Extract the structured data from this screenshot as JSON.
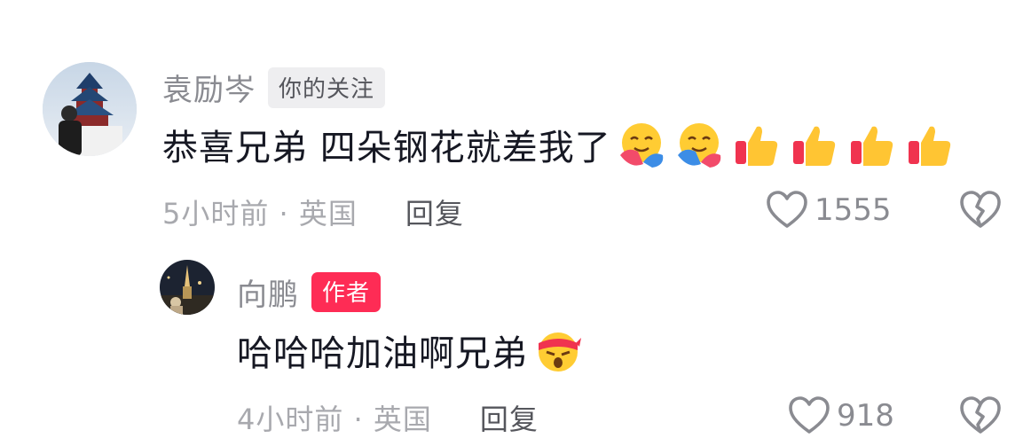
{
  "comments": [
    {
      "username": "袁励岑",
      "badge": "你的关注",
      "text": "恭喜兄弟 四朵钢花就差我了",
      "emojis": [
        "hug-emoji",
        "hug-emoji",
        "thumbs-up-emoji",
        "thumbs-up-emoji",
        "thumbs-up-emoji",
        "thumbs-up-emoji"
      ],
      "time_location": "5小时前 · 英国",
      "reply_label": "回复",
      "like_count": "1555"
    },
    {
      "username": "向鹏",
      "badge": "作者",
      "text": "哈哈哈加油啊兄弟",
      "emojis": [
        "determined-headband-emoji"
      ],
      "time_location": "4小时前 · 英国",
      "reply_label": "回复",
      "like_count": "918"
    }
  ],
  "colors": {
    "username": "#8a8b91",
    "author_badge": "#fe2c55",
    "follow_badge_bg": "#eeeef0",
    "meta": "#a8a9ae"
  }
}
